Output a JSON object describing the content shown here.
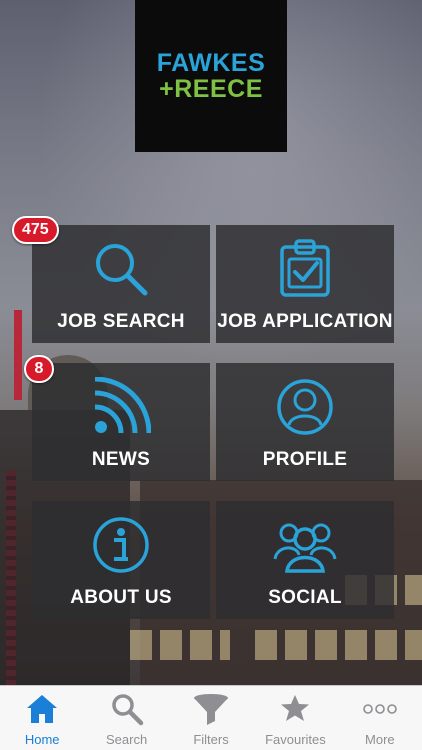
{
  "logo": {
    "line1": "FAWKES",
    "plus": "+",
    "line2": "REECE"
  },
  "tiles": [
    {
      "label": "JOB SEARCH",
      "icon": "magnifier-icon",
      "badge": "475"
    },
    {
      "label": "JOB APPLICATION",
      "icon": "clipboard-check-icon"
    },
    {
      "label": "NEWS",
      "icon": "rss-icon",
      "badge": "8"
    },
    {
      "label": "PROFILE",
      "icon": "user-circle-icon"
    },
    {
      "label": "ABOUT US",
      "icon": "info-icon"
    },
    {
      "label": "SOCIAL",
      "icon": "people-group-icon"
    }
  ],
  "tabbar": {
    "active": "Home",
    "items": [
      {
        "label": "Home",
        "icon": "home-icon"
      },
      {
        "label": "Search",
        "icon": "search-icon"
      },
      {
        "label": "Filters",
        "icon": "funnel-icon"
      },
      {
        "label": "Favourites",
        "icon": "star-icon"
      },
      {
        "label": "More",
        "icon": "more-dots-icon"
      }
    ]
  },
  "colors": {
    "accent": "#2aa3d8",
    "logo_green": "#7fc144",
    "badge": "#d7192a",
    "tab_active": "#1a7fd6",
    "tab_inactive": "#8e8e93"
  }
}
